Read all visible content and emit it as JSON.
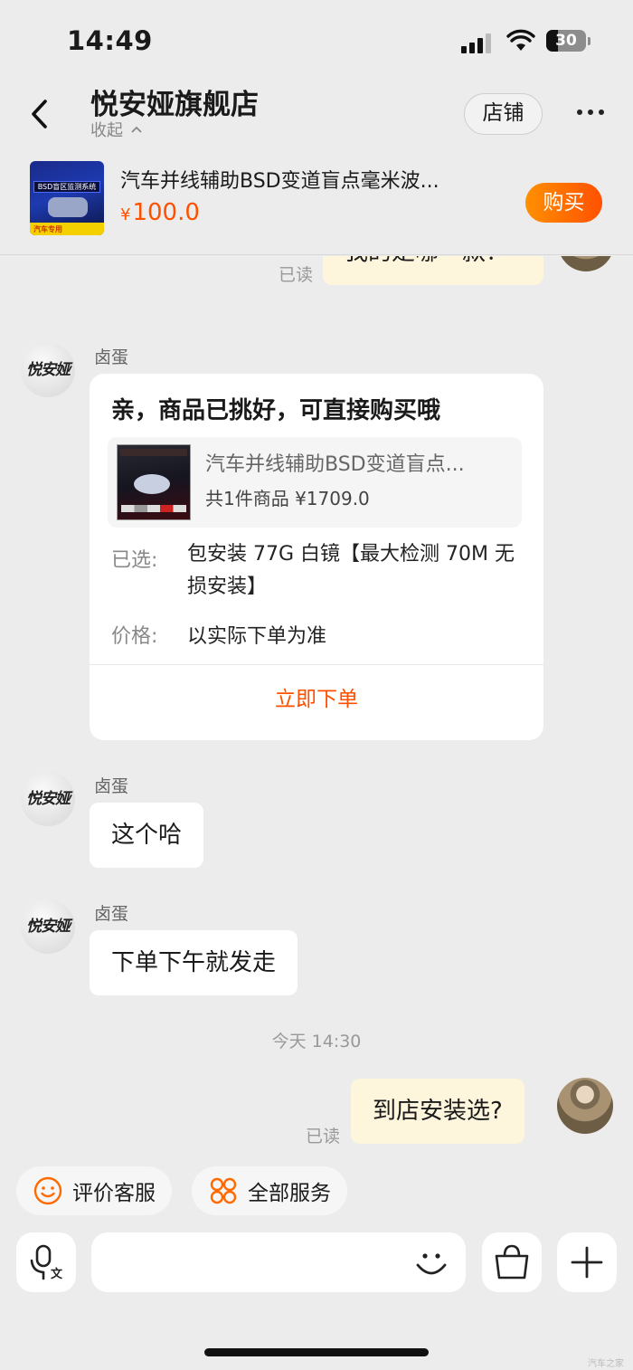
{
  "status_bar": {
    "time": "14:49",
    "battery": "30"
  },
  "header": {
    "store_name": "悦安娅旗舰店",
    "collapse_label": "收起",
    "shop_button": "店铺"
  },
  "product": {
    "title": "汽车并线辅助BSD变道盲点毫米波...",
    "currency": "¥",
    "price": "100.0",
    "buy_button": "购买",
    "thumb_band": "BSD盲区监测系统",
    "thumb_foot": "汽车专用"
  },
  "chat": {
    "partial_read": "已读",
    "partial_text": "我的是哪一款？",
    "store_avatar_text": "悦安娅",
    "messages": [
      {
        "sender": "卤蛋"
      },
      {
        "sender": "卤蛋",
        "text": "这个哈"
      },
      {
        "sender": "卤蛋",
        "text": "下单下午就发走"
      }
    ],
    "card": {
      "title": "亲，商品已挑好，可直接购买哦",
      "product_title": "汽车并线辅助BSD变道盲点...",
      "product_sub": "共1件商品 ¥1709.0",
      "selected_label": "已选:",
      "selected_value": "包安装 77G 白镜【最大检测 70M 无损安装】",
      "price_label": "价格:",
      "price_value": "以实际下单为准",
      "order_button": "立即下单"
    },
    "time_divider": "今天 14:30",
    "user_message": {
      "text": "到店安装选?",
      "read": "已读"
    }
  },
  "quick_actions": [
    {
      "label": "评价客服",
      "icon": "smile-icon"
    },
    {
      "label": "全部服务",
      "icon": "services-icon"
    }
  ],
  "input_bar": {
    "voice_icon": "voice-translate-icon",
    "emoji_icon": "emoji-icon",
    "bag_icon": "shopping-bag-icon",
    "plus_icon": "plus-icon"
  },
  "colors": {
    "accent": "#ff5000",
    "background": "#ececec",
    "user_bubble": "#fdf5dc"
  },
  "watermark": "汽车之家"
}
